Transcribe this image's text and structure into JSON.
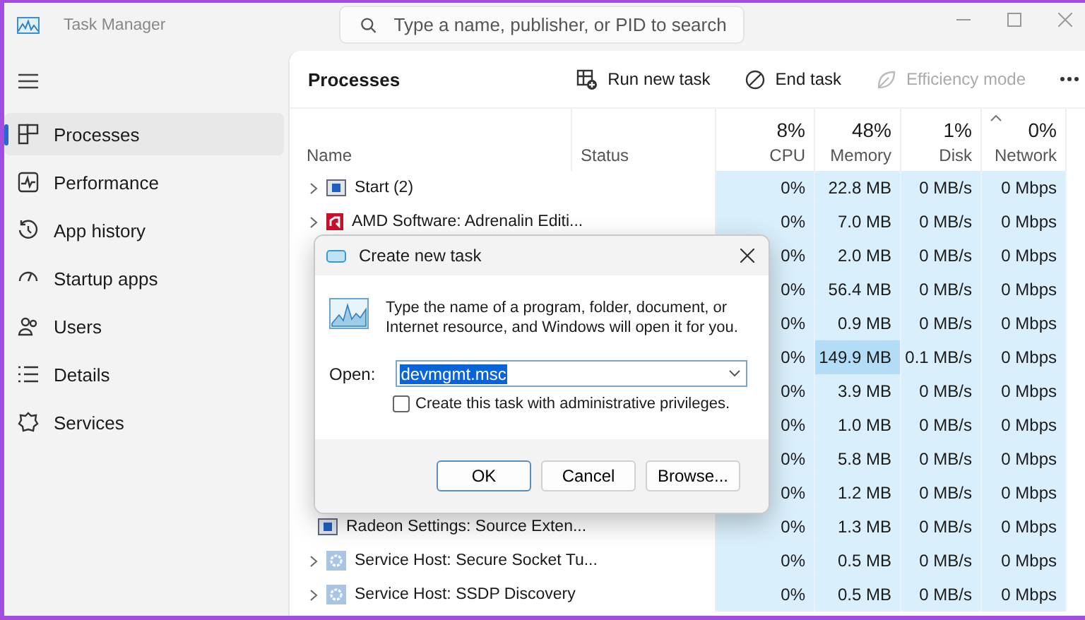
{
  "window": {
    "title": "Task Manager",
    "search_placeholder": "Type a name, publisher, or PID to search"
  },
  "sidebar": {
    "items": [
      {
        "label": "Processes",
        "selected": true
      },
      {
        "label": "Performance",
        "selected": false
      },
      {
        "label": "App history",
        "selected": false
      },
      {
        "label": "Startup apps",
        "selected": false
      },
      {
        "label": "Users",
        "selected": false
      },
      {
        "label": "Details",
        "selected": false
      },
      {
        "label": "Services",
        "selected": false
      }
    ]
  },
  "page": {
    "title": "Processes",
    "toolbar": [
      {
        "label": "Run new task",
        "disabled": false
      },
      {
        "label": "End task",
        "disabled": false
      },
      {
        "label": "Efficiency mode",
        "disabled": true
      }
    ]
  },
  "table": {
    "columns": [
      {
        "label": "Name",
        "sorted": false
      },
      {
        "label": "Status",
        "sorted": false
      },
      {
        "label": "CPU",
        "percent": "8%",
        "sorted": false
      },
      {
        "label": "Memory",
        "percent": "48%",
        "sorted": false
      },
      {
        "label": "Disk",
        "percent": "1%",
        "sorted": false
      },
      {
        "label": "Network",
        "percent": "0%",
        "sorted": true
      }
    ],
    "rows": [
      {
        "name": "Start (2)",
        "kind": "window",
        "expandable": true,
        "cpu": "0%",
        "memory": "22.8 MB",
        "memory_high": false,
        "disk": "0 MB/s",
        "network": "0 Mbps"
      },
      {
        "name": "AMD Software: Adrenalin Editi...",
        "kind": "app",
        "expandable": true,
        "cpu": "0%",
        "memory": "7.0 MB",
        "memory_high": false,
        "disk": "0 MB/s",
        "network": "0 Mbps"
      },
      {
        "cpu": "0%",
        "memory": "2.0 MB",
        "memory_high": false,
        "disk": "0 MB/s",
        "network": "0 Mbps"
      },
      {
        "cpu": "0%",
        "memory": "56.4 MB",
        "memory_high": false,
        "disk": "0 MB/s",
        "network": "0 Mbps"
      },
      {
        "cpu": "0%",
        "memory": "0.9 MB",
        "memory_high": false,
        "disk": "0 MB/s",
        "network": "0 Mbps"
      },
      {
        "cpu": "0%",
        "memory": "149.9 MB",
        "memory_high": true,
        "disk": "0.1 MB/s",
        "network": "0 Mbps"
      },
      {
        "cpu": "0%",
        "memory": "3.9 MB",
        "memory_high": false,
        "disk": "0 MB/s",
        "network": "0 Mbps"
      },
      {
        "cpu": "0%",
        "memory": "1.0 MB",
        "memory_high": false,
        "disk": "0 MB/s",
        "network": "0 Mbps"
      },
      {
        "cpu": "0%",
        "memory": "5.8 MB",
        "memory_high": false,
        "disk": "0 MB/s",
        "network": "0 Mbps"
      },
      {
        "cpu": "0%",
        "memory": "1.2 MB",
        "memory_high": false,
        "disk": "0 MB/s",
        "network": "0 Mbps"
      },
      {
        "name": "Radeon Settings: Source Exten...",
        "kind": "window",
        "cpu": "0%",
        "memory": "1.3 MB",
        "memory_high": false,
        "disk": "0 MB/s",
        "network": "0 Mbps"
      },
      {
        "name": "Service Host: Secure Socket Tu...",
        "kind": "service",
        "expandable": true,
        "cpu": "0%",
        "memory": "0.5 MB",
        "memory_high": false,
        "disk": "0 MB/s",
        "network": "0 Mbps"
      },
      {
        "name": "Service Host: SSDP Discovery",
        "kind": "service",
        "expandable": true,
        "cpu": "0%",
        "memory": "0.5 MB",
        "memory_high": false,
        "disk": "0 MB/s",
        "network": "0 Mbps"
      }
    ]
  },
  "dialog": {
    "title": "Create new task",
    "message": "Type the name of a program, folder, document, or Internet resource, and Windows will open it for you.",
    "open_label": "Open:",
    "open_value": "devmgmt.msc",
    "value_selected": true,
    "admin_checkbox": {
      "label": "Create this task with administrative privileges.",
      "checked": false
    },
    "buttons": [
      {
        "label": "OK",
        "default": true
      },
      {
        "label": "Cancel",
        "default": false
      },
      {
        "label": "Browse...",
        "default": false
      }
    ]
  }
}
